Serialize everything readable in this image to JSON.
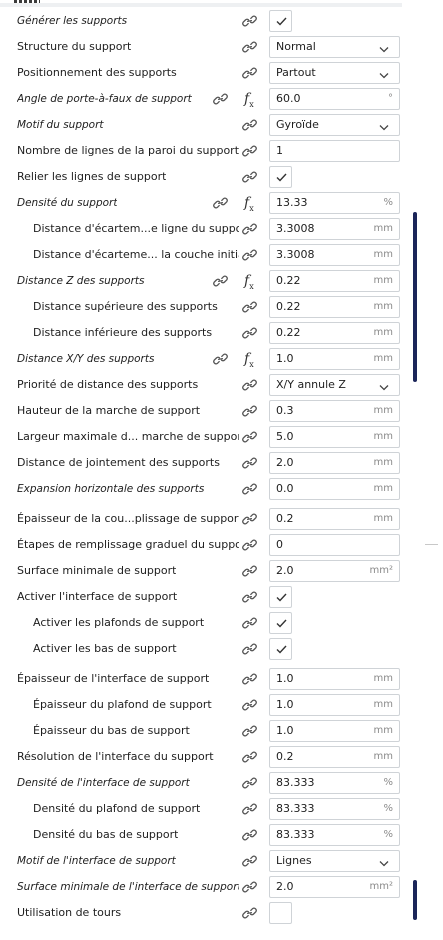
{
  "rows": [
    {
      "label": "Générer les supports",
      "italic": true,
      "indent": false,
      "kind": "check",
      "checked": true,
      "link2": false,
      "fx": false
    },
    {
      "label": "Structure du support",
      "italic": false,
      "indent": false,
      "kind": "select",
      "value": "Normal",
      "link2": false,
      "fx": false
    },
    {
      "label": "Positionnement des supports",
      "italic": false,
      "indent": false,
      "kind": "select",
      "value": "Partout",
      "link2": false,
      "fx": false
    },
    {
      "label": "Angle de porte-à-faux de support",
      "italic": true,
      "indent": false,
      "kind": "input",
      "value": "60.0",
      "unit": "°",
      "link2": true,
      "fx": true
    },
    {
      "label": "Motif du support",
      "italic": true,
      "indent": false,
      "kind": "select",
      "value": "Gyroïde",
      "link2": false,
      "fx": false
    },
    {
      "label": "Nombre de lignes de la paroi du support",
      "italic": false,
      "indent": false,
      "kind": "input",
      "value": "1",
      "unit": "",
      "link2": false,
      "fx": false
    },
    {
      "label": "Relier les lignes de support",
      "italic": false,
      "indent": false,
      "kind": "check",
      "checked": true,
      "link2": false,
      "fx": false
    },
    {
      "label": "Densité du support",
      "italic": true,
      "indent": false,
      "kind": "input",
      "value": "13.33",
      "unit": "%",
      "link2": true,
      "fx": true
    },
    {
      "label": "Distance d'écartem...e ligne du support",
      "italic": false,
      "indent": true,
      "kind": "input",
      "value": "3.3008",
      "unit": "mm",
      "link2": false,
      "fx": false
    },
    {
      "label": "Distance d'écarteme... la couche initiale",
      "italic": false,
      "indent": true,
      "kind": "input",
      "value": "3.3008",
      "unit": "mm",
      "link2": false,
      "fx": false
    },
    {
      "label": "Distance Z des supports",
      "italic": true,
      "indent": false,
      "kind": "input",
      "value": "0.22",
      "unit": "mm",
      "link2": true,
      "fx": true
    },
    {
      "label": "Distance supérieure des supports",
      "italic": false,
      "indent": true,
      "kind": "input",
      "value": "0.22",
      "unit": "mm",
      "link2": false,
      "fx": false
    },
    {
      "label": "Distance inférieure des supports",
      "italic": false,
      "indent": true,
      "kind": "input",
      "value": "0.22",
      "unit": "mm",
      "link2": false,
      "fx": false
    },
    {
      "label": "Distance X/Y des supports",
      "italic": true,
      "indent": false,
      "kind": "input",
      "value": "1.0",
      "unit": "mm",
      "link2": true,
      "fx": true
    },
    {
      "label": "Priorité de distance des supports",
      "italic": false,
      "indent": false,
      "kind": "select",
      "value": "X/Y annule Z",
      "link2": false,
      "fx": false
    },
    {
      "label": "Hauteur de la marche de support",
      "italic": false,
      "indent": false,
      "kind": "input",
      "value": "0.3",
      "unit": "mm",
      "link2": false,
      "fx": false
    },
    {
      "label": "Largeur maximale d... marche de support",
      "italic": false,
      "indent": false,
      "kind": "input",
      "value": "5.0",
      "unit": "mm",
      "link2": false,
      "fx": false
    },
    {
      "label": "Distance de jointement des supports",
      "italic": false,
      "indent": false,
      "kind": "input",
      "value": "2.0",
      "unit": "mm",
      "link2": false,
      "fx": false
    },
    {
      "label": "Expansion horizontale des supports",
      "italic": true,
      "indent": false,
      "kind": "input",
      "value": "0.0",
      "unit": "mm",
      "link2": false,
      "fx": false
    },
    {
      "label": "Épaisseur de la cou...plissage de support",
      "italic": false,
      "indent": false,
      "kind": "input",
      "value": "0.2",
      "unit": "mm",
      "link2": false,
      "fx": false,
      "sep": true
    },
    {
      "label": "Étapes de remplissage graduel du support",
      "italic": false,
      "indent": false,
      "kind": "input",
      "value": "0",
      "unit": "",
      "link2": false,
      "fx": false
    },
    {
      "label": "Surface minimale de support",
      "italic": false,
      "indent": false,
      "kind": "input",
      "value": "2.0",
      "unit": "mm²",
      "link2": false,
      "fx": false
    },
    {
      "label": "Activer l'interface de support",
      "italic": false,
      "indent": false,
      "kind": "check",
      "checked": true,
      "link2": false,
      "fx": false
    },
    {
      "label": "Activer les plafonds de support",
      "italic": false,
      "indent": true,
      "kind": "check",
      "checked": true,
      "link2": false,
      "fx": false
    },
    {
      "label": "Activer les bas de support",
      "italic": false,
      "indent": true,
      "kind": "check",
      "checked": true,
      "link2": false,
      "fx": false
    },
    {
      "label": "Épaisseur de l'interface de support",
      "italic": false,
      "indent": false,
      "kind": "input",
      "value": "1.0",
      "unit": "mm",
      "link2": false,
      "fx": false,
      "sep": true
    },
    {
      "label": "Épaisseur du plafond de support",
      "italic": false,
      "indent": true,
      "kind": "input",
      "value": "1.0",
      "unit": "mm",
      "link2": false,
      "fx": false
    },
    {
      "label": "Épaisseur du bas de support",
      "italic": false,
      "indent": true,
      "kind": "input",
      "value": "1.0",
      "unit": "mm",
      "link2": false,
      "fx": false
    },
    {
      "label": "Résolution de l'interface du support",
      "italic": false,
      "indent": false,
      "kind": "input",
      "value": "0.2",
      "unit": "mm",
      "link2": false,
      "fx": false
    },
    {
      "label": "Densité de l'interface de support",
      "italic": true,
      "indent": false,
      "kind": "input",
      "value": "83.333",
      "unit": "%",
      "link2": false,
      "fx": false
    },
    {
      "label": "Densité du plafond de support",
      "italic": false,
      "indent": true,
      "kind": "input",
      "value": "83.333",
      "unit": "%",
      "link2": false,
      "fx": false
    },
    {
      "label": "Densité du bas de support",
      "italic": false,
      "indent": true,
      "kind": "input",
      "value": "83.333",
      "unit": "%",
      "link2": false,
      "fx": false
    },
    {
      "label": "Motif de l'interface de support",
      "italic": true,
      "indent": false,
      "kind": "select",
      "value": "Lignes",
      "link2": false,
      "fx": false
    },
    {
      "label": "Surface minimale de l'interface de support",
      "italic": true,
      "indent": false,
      "kind": "input",
      "value": "2.0",
      "unit": "mm²",
      "link2": false,
      "fx": false
    },
    {
      "label": "Utilisation de tours",
      "italic": false,
      "indent": false,
      "kind": "check",
      "checked": false,
      "link2": false,
      "fx": false
    }
  ]
}
